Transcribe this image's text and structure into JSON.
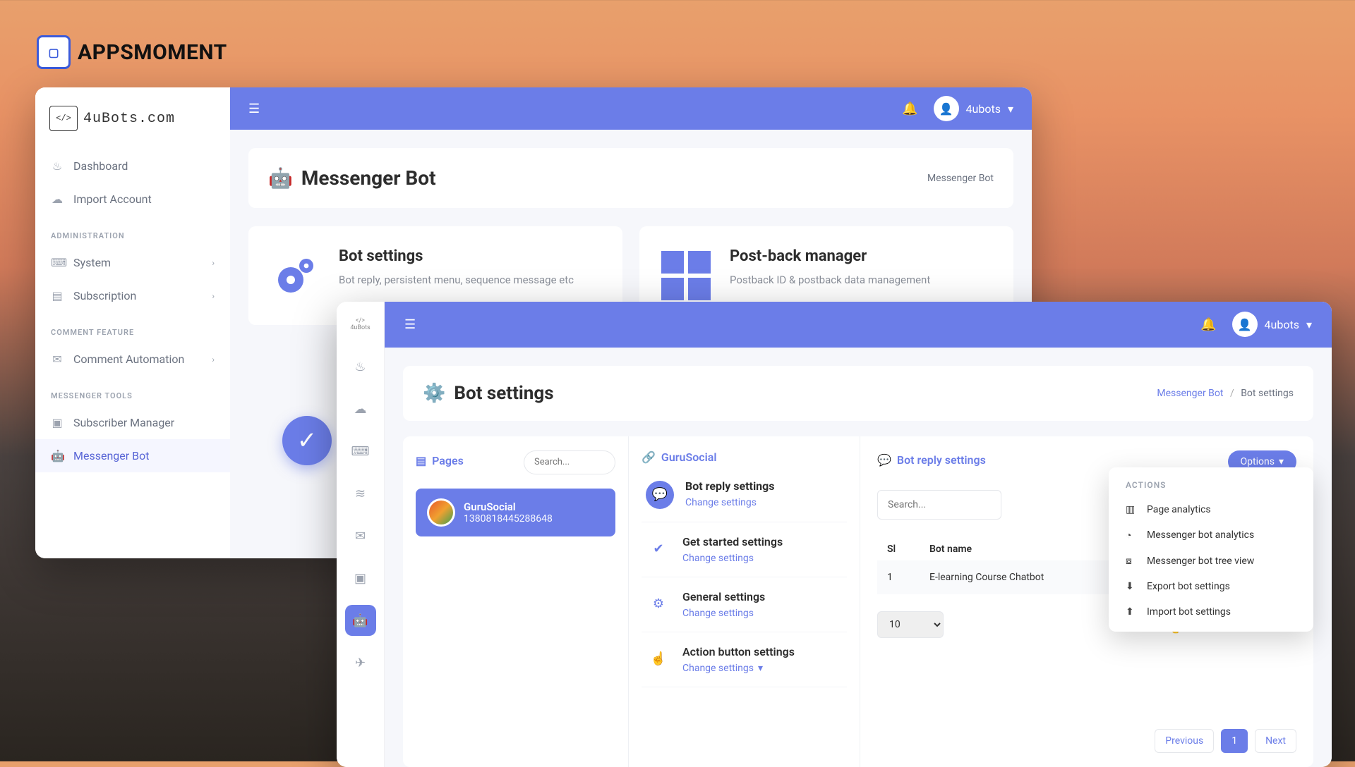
{
  "brand": {
    "name": "APPSMOMENT"
  },
  "win1": {
    "brand_text": "4uBots.com",
    "sidebar": {
      "items": [
        {
          "label": "Dashboard",
          "icon": "flame"
        },
        {
          "label": "Import Account",
          "icon": "cloud-up"
        }
      ],
      "headings": {
        "administration": "ADMINISTRATION",
        "comment_feature": "COMMENT FEATURE",
        "messenger_tools": "MESSENGER TOOLS"
      },
      "admin": [
        {
          "label": "System"
        },
        {
          "label": "Subscription"
        }
      ],
      "comment": [
        {
          "label": "Comment Automation"
        }
      ],
      "messenger": [
        {
          "label": "Subscriber Manager"
        },
        {
          "label": "Messenger Bot"
        }
      ]
    },
    "user_label": "4ubots",
    "page_title": "Messenger Bot",
    "breadcrumb": "Messenger Bot",
    "cards": [
      {
        "title": "Bot settings",
        "sub": "Bot reply, persistent menu, sequence message etc"
      },
      {
        "title": "Post-back manager",
        "sub": "Postback ID & postback data management"
      }
    ]
  },
  "win2": {
    "user_label": "4ubots",
    "iconbar_brand": "4uBots",
    "page_title": "Bot settings",
    "breadcrumb": {
      "root": "Messenger Bot",
      "current": "Bot settings"
    },
    "pages": {
      "head": "Pages",
      "search_placeholder": "Search...",
      "item": {
        "name": "GuruSocial",
        "id": "1380818445288648"
      }
    },
    "guru": {
      "head": "GuruSocial",
      "rows": [
        {
          "title": "Bot reply settings",
          "sub": "Change settings",
          "icon": "chat"
        },
        {
          "title": "Get started settings",
          "sub": "Change settings",
          "icon": "check"
        },
        {
          "title": "General settings",
          "sub": "Change settings",
          "icon": "gear"
        },
        {
          "title": "Action button settings",
          "sub": "Change settings",
          "icon": "pointer",
          "caret": true
        }
      ]
    },
    "reply": {
      "head": "Bot reply settings",
      "options_label": "Options",
      "search_placeholder": "Search...",
      "table": {
        "col_sl": "Sl",
        "col_name": "Bot name",
        "rows": [
          {
            "sl": "1",
            "name": "E-learning Course Chatbot"
          }
        ]
      },
      "pagesize": "10",
      "pager": {
        "prev": "Previous",
        "next": "Next",
        "current": "1"
      }
    },
    "actions_menu": {
      "title": "ACTIONS",
      "items": [
        {
          "label": "Page analytics",
          "icon": "bar-chart"
        },
        {
          "label": "Messenger bot analytics",
          "icon": "pie-chart"
        },
        {
          "label": "Messenger bot tree view",
          "icon": "sitemap"
        },
        {
          "label": "Export bot settings",
          "icon": "file-export"
        },
        {
          "label": "Import bot settings",
          "icon": "file-import"
        }
      ]
    }
  }
}
